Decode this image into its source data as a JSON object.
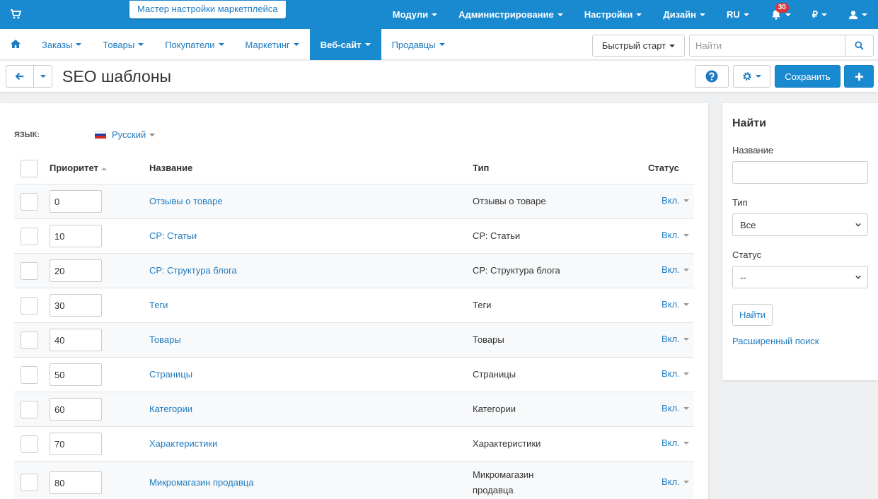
{
  "colors": {
    "primary": "#1a8ad0",
    "link": "#1f7bbf",
    "badge": "#d9353a"
  },
  "topbar": {
    "wizard_tip": "Мастер настройки маркетплейса",
    "menu": [
      "Модули",
      "Администрирование",
      "Настройки",
      "Дизайн",
      "RU"
    ],
    "notifications_count": "30",
    "currency": "₽"
  },
  "nav": {
    "items": [
      "Заказы",
      "Товары",
      "Покупатели",
      "Маркетинг",
      "Веб-сайт",
      "Продавцы"
    ],
    "active": "Веб-сайт",
    "quick_start": "Быстрый старт",
    "search_placeholder": "Найти"
  },
  "page": {
    "title": "SEO шаблоны",
    "save_label": "Сохранить"
  },
  "language": {
    "label": "ЯЗЫК:",
    "value": "Русский"
  },
  "table": {
    "headers": {
      "priority": "Приоритет",
      "name": "Название",
      "type": "Тип",
      "status": "Статус"
    },
    "rows": [
      {
        "priority": "0",
        "name": "Отзывы о товаре",
        "type": "Отзывы о товаре",
        "status": "Вкл."
      },
      {
        "priority": "10",
        "name": "СР: Статьи",
        "type": "СР: Статьи",
        "status": "Вкл."
      },
      {
        "priority": "20",
        "name": "СР: Структура блога",
        "type": "СР: Структура блога",
        "status": "Вкл."
      },
      {
        "priority": "30",
        "name": "Теги",
        "type": "Теги",
        "status": "Вкл."
      },
      {
        "priority": "40",
        "name": "Товары",
        "type": "Товары",
        "status": "Вкл."
      },
      {
        "priority": "50",
        "name": "Страницы",
        "type": "Страницы",
        "status": "Вкл."
      },
      {
        "priority": "60",
        "name": "Категории",
        "type": "Категории",
        "status": "Вкл."
      },
      {
        "priority": "70",
        "name": "Характеристики",
        "type": "Характеристики",
        "status": "Вкл."
      },
      {
        "priority": "80",
        "name": "Микромагазин продавца",
        "type": "Микромагазин продавца",
        "status": "Вкл."
      }
    ]
  },
  "sidebar": {
    "title": "Найти",
    "name_label": "Название",
    "type_label": "Тип",
    "type_value": "Все",
    "status_label": "Статус",
    "status_value": "--",
    "find_button": "Найти",
    "advanced_search": "Расширенный поиск"
  }
}
